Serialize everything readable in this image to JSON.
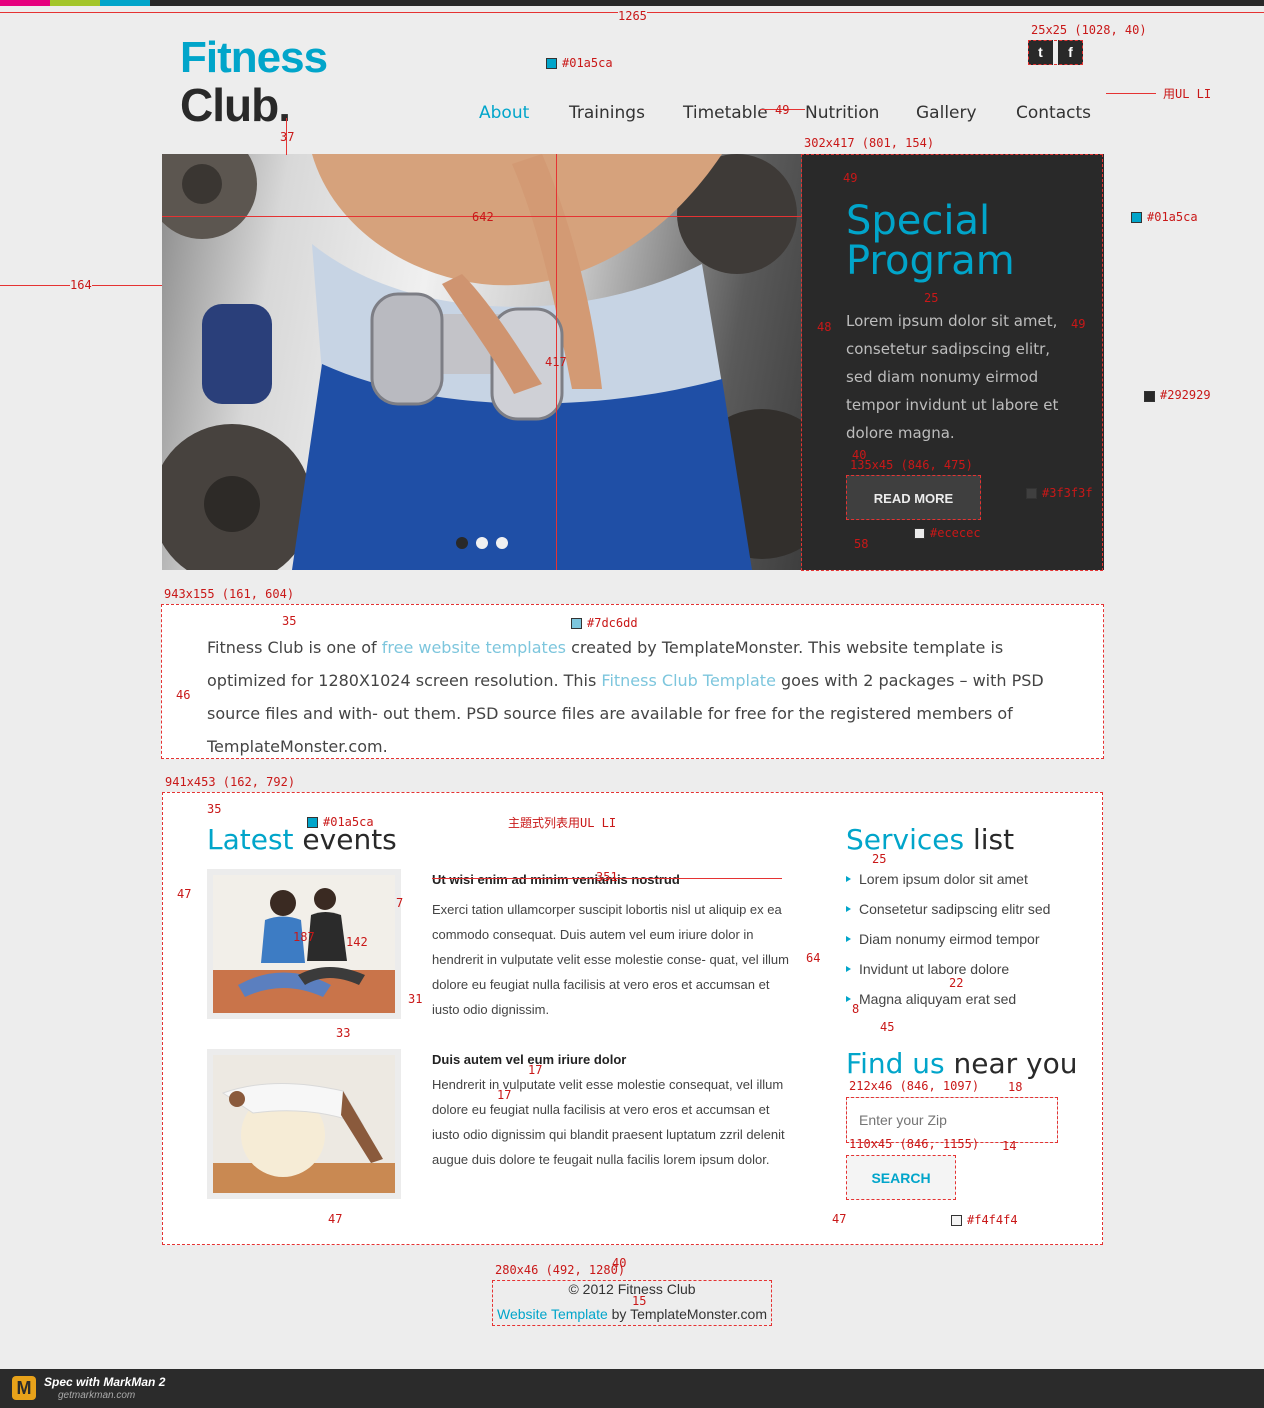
{
  "brand": {
    "line1": "Fitness",
    "line2": "Club."
  },
  "nav": {
    "items": [
      "About",
      "Trainings",
      "Timetable",
      "Nutrition",
      "Gallery",
      "Contacts"
    ],
    "active": "About"
  },
  "social": {
    "twitter_glyph": "t",
    "facebook_glyph": "f"
  },
  "special": {
    "title_line1": "Special",
    "title_line2": "Program",
    "text": "Lorem ipsum dolor sit amet, consetetur sadipscing elitr, sed diam nonumy eirmod tempor invidunt ut labore et dolore magna.",
    "button": "READ MORE"
  },
  "slider": {
    "dots": 3,
    "active_index": 0
  },
  "intro": {
    "t1": "Fitness Club is one of ",
    "link1": "free website templates",
    "t2": " created by TemplateMonster. This website template is optimized for 1280X1024 screen resolution. This ",
    "link2": "Fitness Club Template",
    "t3": " goes with 2 packages – with PSD source files and with- out them. PSD source files are available for free for the registered members of TemplateMonster.com."
  },
  "events": {
    "heading_blue": "Latest",
    "heading_dark": " events",
    "items": [
      {
        "title": "Ut wisi enim ad minim veniamis nostrud",
        "text": "Exerci tation ullamcorper suscipit lobortis nisl ut aliquip ex ea commodo consequat. Duis autem vel eum iriure dolor in hendrerit in vulputate velit esse molestie conse- quat, vel illum dolore eu feugiat nulla facilisis at vero eros et accumsan et iusto odio dignissim."
      },
      {
        "title": "Duis autem vel eum iriure dolor",
        "text": "Hendrerit in vulputate velit esse molestie consequat, vel illum dolore eu feugiat nulla facilisis at vero eros et accumsan et iusto odio dignissim qui blandit praesent luptatum zzril delenit augue duis dolore te feugait nulla facilis lorem ipsum dolor."
      }
    ]
  },
  "services": {
    "heading_blue": "Services",
    "heading_dark": " list",
    "items": [
      "Lorem ipsum dolor sit amet",
      "Consetetur sadipscing elitr sed",
      "Diam nonumy eirmod tempor",
      "Invidunt ut labore dolore",
      "Magna aliquyam erat sed"
    ]
  },
  "find": {
    "heading_blue": "Find us",
    "heading_dark": " near you",
    "placeholder": "Enter your Zip",
    "button": "SEARCH"
  },
  "footer": {
    "copyright": "© 2012 Fitness Club",
    "link": "Website Template",
    "by": " by TemplateMonster.com"
  },
  "colors": {
    "accent": "#01a5ca",
    "dark": "#292929",
    "button_bg": "#3f3f3f",
    "button_text": "#ececec",
    "link": "#7dc6dd",
    "search_bg": "#f4f4f4",
    "strip": [
      "#e6007e",
      "#a3c52a",
      "#01a5ca"
    ]
  },
  "spec": {
    "page_width": "1265",
    "social_size": "25x25 (1028, 40)",
    "ul_li": "用UL LI",
    "nav_color": "#01a5ca",
    "nav_gap": "49",
    "logo_gap": "37",
    "left_margin": "164",
    "hero_width": "642",
    "hero_height": "417",
    "panel_size": "302x417 (801, 154)",
    "panel_top": "49",
    "title_color": "#01a5ca",
    "title_gap": "25",
    "panel_left": "48",
    "panel_right": "49",
    "panel_color": "#292929",
    "btn_gap": "40",
    "btn_size": "135x45 (846, 475)",
    "btn_color": "#3f3f3f",
    "btn_text_color": "#ececec",
    "btn_bottom": "58",
    "intro_size": "943x155 (161, 604)",
    "intro_top": "35",
    "link_color": "#7dc6dd",
    "intro_left": "46",
    "main_size": "941x453 (162, 792)",
    "main_top": "35",
    "heading_color": "#01a5ca",
    "list_note": "主題式列表用UL LI",
    "ev_left": "47",
    "ev_title_w": "351",
    "thumb_pad": "7",
    "thumb_w": "187",
    "thumb_h": "142",
    "ev_right": "64",
    "thumb_text_gap": "31",
    "ev_gap": "33",
    "ev_inner": "17",
    "ev_inner2": "17",
    "ev_bottom": "47",
    "svc_gap": "25",
    "svc_line": "22",
    "svc_indent": "8",
    "svc_bottom": "45",
    "zip_size": "212x46 (846, 1097)",
    "zip_gap": "18",
    "zip_btn_gap": "14",
    "search_size": "110x45 (846, 1155)",
    "search_color": "#f4f4f4",
    "svc_bottom2": "47",
    "foot_gap": "40",
    "foot_size": "280x46 (492, 1280)",
    "foot_line": "15"
  },
  "markman": {
    "label": "Spec with MarkMan 2",
    "url": "getmarkman.com"
  }
}
